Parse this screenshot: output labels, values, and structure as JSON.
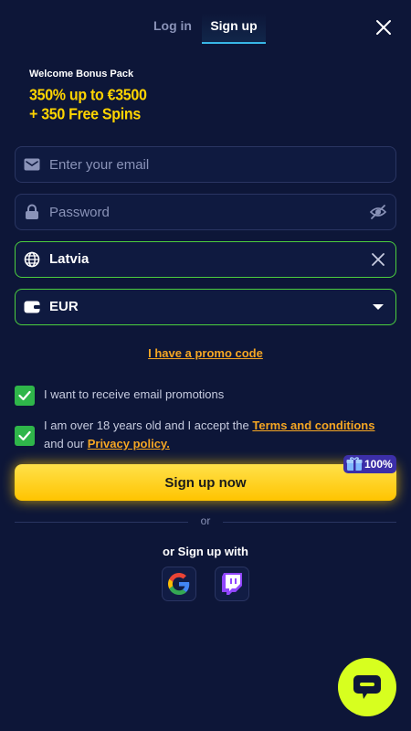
{
  "tabs": [
    {
      "label": "Log in"
    },
    {
      "label": "Sign up"
    }
  ],
  "bonus": {
    "kicker": "Welcome Bonus Pack",
    "line1": "350% up to €3500",
    "line2": "+ 350 Free Spins"
  },
  "form": {
    "email": {
      "placeholder": "Enter your email",
      "value": ""
    },
    "password": {
      "placeholder": "Password",
      "value": ""
    },
    "country": {
      "value": "Latvia"
    },
    "currency": {
      "value": "EUR"
    }
  },
  "promo_link": "I have a promo code",
  "checks": {
    "email_promos": {
      "label": "I want to receive email promotions",
      "checked": true
    },
    "terms": {
      "prefix": "I am over 18 years old and I accept the",
      "terms_link": "Terms and conditions",
      "middle": "and our",
      "privacy_link": "Privacy policy.",
      "checked": true
    }
  },
  "signup_button": "Sign up now",
  "badge": {
    "label": "100%"
  },
  "divider": "or",
  "social": {
    "title": "or Sign up with",
    "providers": [
      "google-icon",
      "twitch-icon"
    ]
  },
  "colors": {
    "background": "#0d1638",
    "accent_yellow": "#ffd400",
    "link_orange": "#f5a623",
    "valid_green": "#4ccf3e",
    "chat_lime": "#d7ff1f"
  }
}
